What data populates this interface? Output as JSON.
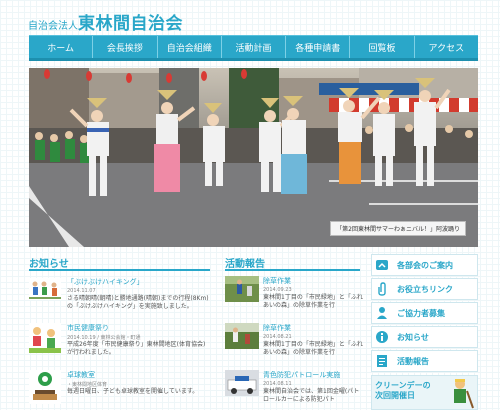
{
  "header": {
    "subtitle": "自治会法人",
    "title": "東林間自治会"
  },
  "nav": [
    {
      "label": "ホーム"
    },
    {
      "label": "会長挨拶"
    },
    {
      "label": "自治会組織"
    },
    {
      "label": "活動計画"
    },
    {
      "label": "各種申請書"
    },
    {
      "label": "回覧板"
    },
    {
      "label": "アクセス"
    }
  ],
  "hero": {
    "caption": "「第2回東林間サマーわぁニバル！」阿波踊り"
  },
  "news": {
    "title": "お知らせ",
    "items": [
      {
        "title": "「ぶけぶけハイキング」",
        "date": "2014.11.07",
        "body": "さる晴朝晴(朝晴)と勝地通路(晴朝)までの行程(8Km)の「ぶけぶけハイキング」を実施致しました。"
      },
      {
        "title": "市民健康祭り",
        "date": "2014.10.19 / 東林公会館・町通",
        "body": "平成26年度「市民健康祭り」東林間地区(体育協会)が行われました。"
      },
      {
        "title": "卓球教室",
        "date": "・東林間地区体育",
        "body": "毎週日曜日、子ども卓球教室を開催しています。"
      }
    ]
  },
  "activity": {
    "title": "活動報告",
    "items": [
      {
        "title": "除草作業",
        "date": "2014.09.23",
        "body": "東林間1丁目の「市民緑地」と「ふれあいの森」の除草作業を行"
      },
      {
        "title": "除草作業",
        "date": "2014.08.21",
        "body": "東林間1丁目の「市民緑地」と「ふれあいの森」の除草作業を行"
      },
      {
        "title": "青色防犯パトロール実施",
        "date": "2014.08.11",
        "body": "東林間自治会では、第1回金曜(パトロールカーによる防犯パト"
      }
    ]
  },
  "sidebar": {
    "items": [
      {
        "label": "各部会のご案内",
        "icon": "people-icon"
      },
      {
        "label": "お役立ちリンク",
        "icon": "paperclip-icon"
      },
      {
        "label": "ご協力者募集",
        "icon": "person-icon"
      },
      {
        "label": "お知らせ",
        "icon": "info-icon"
      },
      {
        "label": "活動報告",
        "icon": "document-icon"
      }
    ],
    "clean_day": {
      "title_line1": "クリーンデーの",
      "title_line2": "次回開催日"
    }
  },
  "colors": {
    "accent": "#2aa7c9",
    "accent_dark": "#1d8fae"
  }
}
